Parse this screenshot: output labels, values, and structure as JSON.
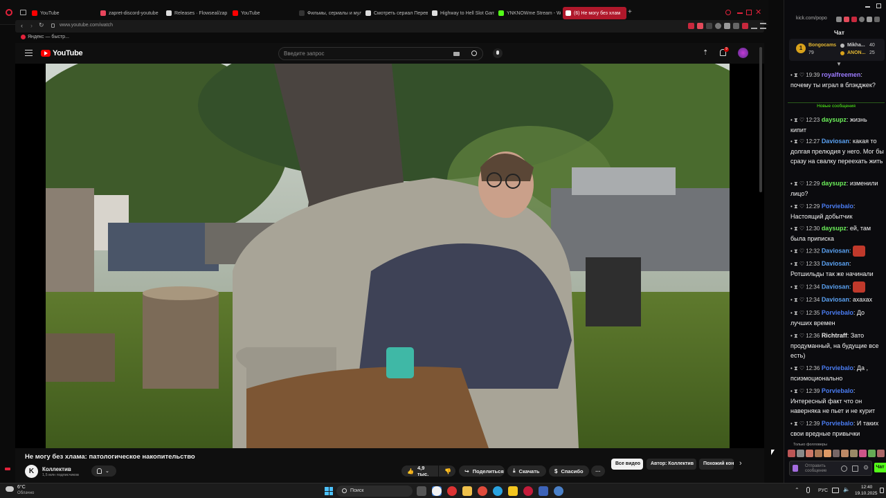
{
  "browser": {
    "tabs": [
      {
        "label": "YouTube",
        "color": "#ff0000"
      },
      {
        "label": "zapret-discord-youtube",
        "color": "#e8455c"
      },
      {
        "label": "Releases · Flowseal/zap",
        "color": "#dddddd"
      },
      {
        "label": "YouTube",
        "color": "#ff0000"
      },
      {
        "label": "Фильмы, сериалы и мул",
        "color": "#333333"
      },
      {
        "label": "Смотреть сериал Перев",
        "color": "#dddddd"
      },
      {
        "label": "Highway to Hell Slot Gam",
        "color": "#dddddd"
      },
      {
        "label": "YNKNOWme Stream - Wi",
        "color": "#53fc18"
      },
      {
        "label": "(6) Не могу без хлам",
        "color": "#ffffff"
      }
    ],
    "new_tab": "+",
    "url": "www.youtube.com/watch",
    "bookmark": "Яндекс — быстр..."
  },
  "youtube": {
    "logo": "YouTube",
    "search_placeholder": "Введите запрос",
    "notif_count": "9",
    "video_title": "Не могу без хлама: патологическое накопительство",
    "channel_name": "Коллектив",
    "channel_initial": "K",
    "subscribers": "1,5 млн подписчиков",
    "likes": "4,9 тыс.",
    "share": "Поделиться",
    "download": "Скачать",
    "thanks": "Спасибо",
    "more": "···",
    "chips": [
      "Все видео",
      "Автор: Коллектив",
      "Похожий кон"
    ]
  },
  "chat": {
    "url": "kick.com/popo",
    "title": "Чат",
    "pinned_user": "Bongocams",
    "pinned_count": "79",
    "top_users": [
      {
        "name": "Mikha...",
        "count": "40"
      },
      {
        "name": "ANON...",
        "count": "25"
      }
    ],
    "divider": "Новые сообщения",
    "messages": [
      {
        "time": "19:39",
        "user": "royalfreemen",
        "color": "#9c7bff",
        "text": "почему ты играл в блэкджек?"
      },
      {
        "time": "12:23",
        "user": "daysupz",
        "color": "#6cf05a",
        "text": "жизнь кипит"
      },
      {
        "time": "12:27",
        "user": "Daviosan",
        "color": "#5aa0f0",
        "text": "какая то долгая прелюдия у него. Мог бы сразу на свалку переехать жить"
      },
      {
        "time": "12:29",
        "user": "daysupz",
        "color": "#6cf05a",
        "text": "изменили лицо?"
      },
      {
        "time": "12:29",
        "user": "Porviebalo",
        "color": "#4a7cf2",
        "text": "Настоящий добытчик"
      },
      {
        "time": "12:30",
        "user": "daysupz",
        "color": "#6cf05a",
        "text": "ей, там была приписка"
      },
      {
        "time": "12:32",
        "user": "Daviosan",
        "color": "#5aa0f0",
        "text": ""
      },
      {
        "time": "12:33",
        "user": "Daviosan",
        "color": "#5aa0f0",
        "text": "Ротшильды так же начинали"
      },
      {
        "time": "12:34",
        "user": "Daviosan",
        "color": "#5aa0f0",
        "text": ""
      },
      {
        "time": "12:34",
        "user": "Daviosan",
        "color": "#5aa0f0",
        "text": "ахахах"
      },
      {
        "time": "12:35",
        "user": "Porviebalo",
        "color": "#4a7cf2",
        "text": "До лучших времен"
      },
      {
        "time": "12:36",
        "user": "Richtraff",
        "color": "#e8e8e8",
        "text": "Зато продуманный, на будущие все есть)"
      },
      {
        "time": "12:36",
        "user": "Porviebalo",
        "color": "#4a7cf2",
        "text": "Да , псиэмоционально"
      },
      {
        "time": "12:39",
        "user": "Porviebalo",
        "color": "#4a7cf2",
        "text": "Интересный факт что он наверняка не пьет и не курит"
      },
      {
        "time": "12:39",
        "user": "Porviebalo",
        "color": "#4a7cf2",
        "text": "И таких свои вредные привычки"
      }
    ],
    "followers_only": "Только фолловеры",
    "send_placeholder": "Отправить сообщение",
    "send_button": "Чат"
  },
  "taskbar": {
    "weather_temp": "6°C",
    "weather_desc": "Облачно",
    "search": "Поиск",
    "lang": "РУС",
    "time": "12:40",
    "date": "19.10.2025"
  }
}
